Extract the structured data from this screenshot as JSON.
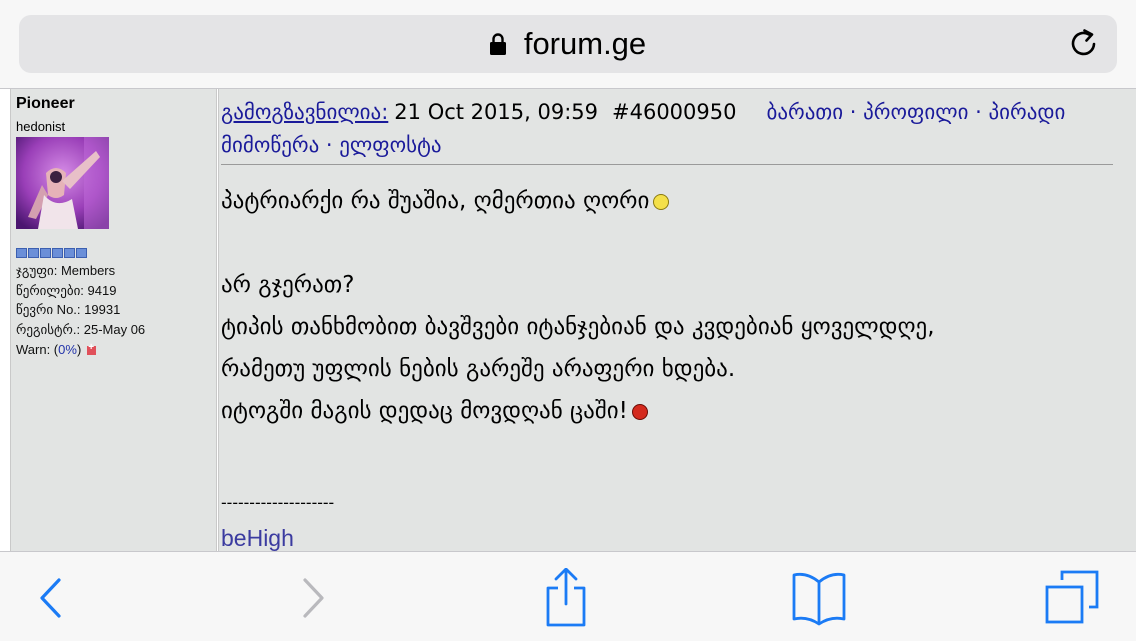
{
  "browser": {
    "url": "forum.ge"
  },
  "author": {
    "name": "Pioneer",
    "title": "hedonist",
    "stats": [
      {
        "label": "ჯგუფი:",
        "value": "Members"
      },
      {
        "label": "წერილები:",
        "value": "9419"
      },
      {
        "label": "წევრი No.:",
        "value": "19931"
      },
      {
        "label": "რეგისტრ.:",
        "value": "25-May 06"
      }
    ],
    "warn_label": "Warn: (",
    "warn_value": "0%",
    "warn_suffix": ")"
  },
  "post": {
    "sent_label": "გამოგზავნილია:",
    "timestamp": "21 Oct 2015, 09:59",
    "post_id": "#46000950",
    "links": [
      "ბარათი",
      "პროფილი",
      "პირადი მიმოწერა",
      "ელფოსტა"
    ],
    "link_separator": " · ",
    "lines": [
      "პატრიარქი რა შუაშია, ღმერთია ღორი",
      "",
      "არ გჯერათ?",
      "ტიპის თანხმობით ბავშვები იტანჯებიან და კვდებიან ყოველდღე,",
      "რამეთუ უფლის ნების გარეშე არაფერი ხდება.",
      "იტოგში მაგის დედაც მოვდღან ცაში!"
    ],
    "signature_separator": "--------------------",
    "signature": "beHigh"
  },
  "icons": {
    "lock": "lock-icon",
    "reload": "reload-icon",
    "back": "back-arrow-icon",
    "forward": "forward-arrow-icon",
    "share": "share-icon",
    "bookmarks": "bookmarks-icon",
    "tabs": "tabs-icon"
  },
  "colors": {
    "accent": "#1b7bf5",
    "link": "#1a1a9a",
    "post_background": "#e2e4e3"
  }
}
